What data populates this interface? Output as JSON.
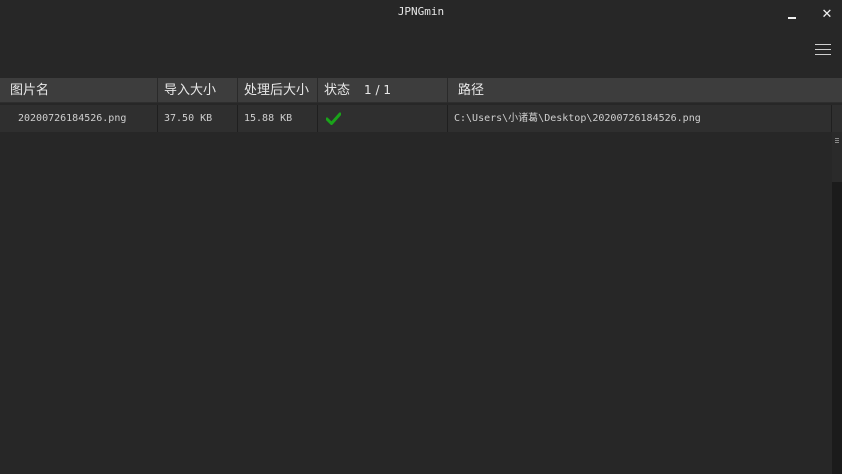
{
  "window": {
    "title": "JPNGmin",
    "minimize_icon": "minimize-icon",
    "close_icon": "close-icon",
    "close_glyph": "✕",
    "menu_icon": "hamburger-menu-icon"
  },
  "table": {
    "headers": {
      "name": "图片名",
      "input_size": "导入大小",
      "output_size": "处理后大小",
      "status": "状态",
      "status_count": "1 / 1",
      "path": "路径"
    },
    "rows": [
      {
        "name": "20200726184526.png",
        "input_size": "37.50 KB",
        "output_size": "15.88 KB",
        "status_icon": "checkmark-icon",
        "path": "C:\\Users\\小诸葛\\Desktop\\20200726184526.png"
      }
    ]
  },
  "colors": {
    "background": "#272727",
    "header_bg": "#3d3d3d",
    "row_bg": "#2f2f2f",
    "success": "#1aa31a"
  }
}
